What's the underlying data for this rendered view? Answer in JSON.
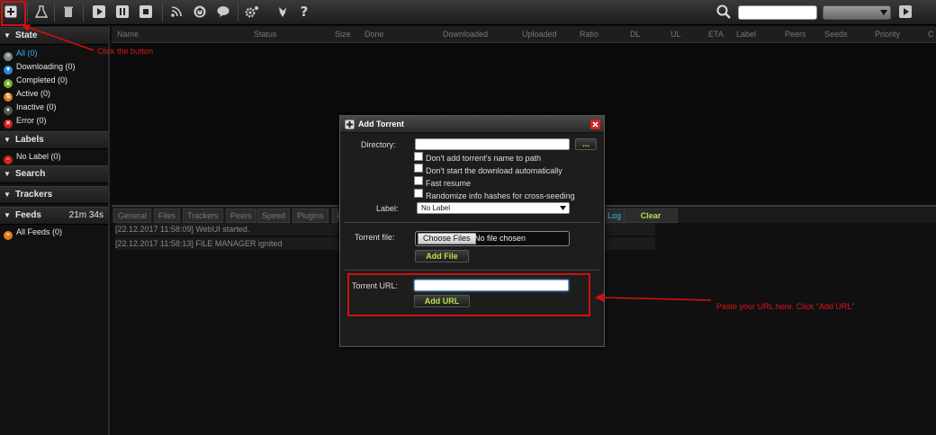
{
  "toolbar": {
    "icons": [
      "add-icon",
      "flask-icon",
      "trash-icon",
      "play-icon",
      "pause-icon",
      "stop-icon",
      "rss-icon",
      "power-icon",
      "chat-icon",
      "gear-icon",
      "logo-icon",
      "help-icon",
      "search-icon",
      "go-icon"
    ],
    "help_label": "?"
  },
  "sidebar": {
    "state_header": "State",
    "state_items": [
      {
        "label": "All (0)",
        "icon": "all-icon",
        "color": "#7a8a8a"
      },
      {
        "label": "Downloading (0)",
        "icon": "downloading-icon",
        "color": "#2a8ad4"
      },
      {
        "label": "Completed (0)",
        "icon": "completed-icon",
        "color": "#7ab02a"
      },
      {
        "label": "Active (0)",
        "icon": "active-icon",
        "color": "#e07a1a"
      },
      {
        "label": "Inactive (0)",
        "icon": "inactive-icon",
        "color": "#555555"
      },
      {
        "label": "Error (0)",
        "icon": "error-icon",
        "color": "#d0201a"
      }
    ],
    "labels_header": "Labels",
    "label_items": [
      {
        "label": "No Label (0)",
        "color": "#d0201a"
      }
    ],
    "search_header": "Search",
    "trackers_header": "Trackers",
    "feeds_header": "Feeds",
    "feeds_time": "21m 34s",
    "feed_items": [
      {
        "label": "All Feeds (0)",
        "color": "#e07a1a"
      }
    ]
  },
  "list": {
    "columns": [
      "Name",
      "Status",
      "Size",
      "Done",
      "Downloaded",
      "Uploaded",
      "Ratio",
      "DL",
      "UL",
      "ETA",
      "Label",
      "Peers",
      "Seeds",
      "Priority",
      "C"
    ]
  },
  "lower": {
    "tabs": [
      "General",
      "Files",
      "Trackers",
      "Peers",
      "Speed",
      "Plugins",
      "F"
    ],
    "log_tab": "Log",
    "clear_label": "Clear",
    "log_lines": [
      "[22.12.2017 11:58:09] WebUI started.",
      "[22.12.2017 11:58:13] FILE MANAGER ignited"
    ]
  },
  "dialog": {
    "title": "Add Torrent",
    "directory_label": "Directory:",
    "browse_label": "...",
    "options": [
      "Don't add torrent's name to path",
      "Don't start the download automatically",
      "Fast resume",
      "Randomize info hashes for cross-seeding"
    ],
    "label_label": "Label:",
    "label_value": "No Label",
    "torrent_file_label": "Torrent file:",
    "choose_files": "Choose Files",
    "no_file": "No file chosen",
    "add_file": "Add File",
    "torrent_url_label": "Torrent URL:",
    "add_url": "Add URL"
  },
  "annotations": {
    "click_button": "Click the button",
    "paste_url": "Paste your URL here. Click \"Add URL\""
  },
  "colors": {
    "annotation_red": "#e01515",
    "button_green": "#b6e04a"
  }
}
